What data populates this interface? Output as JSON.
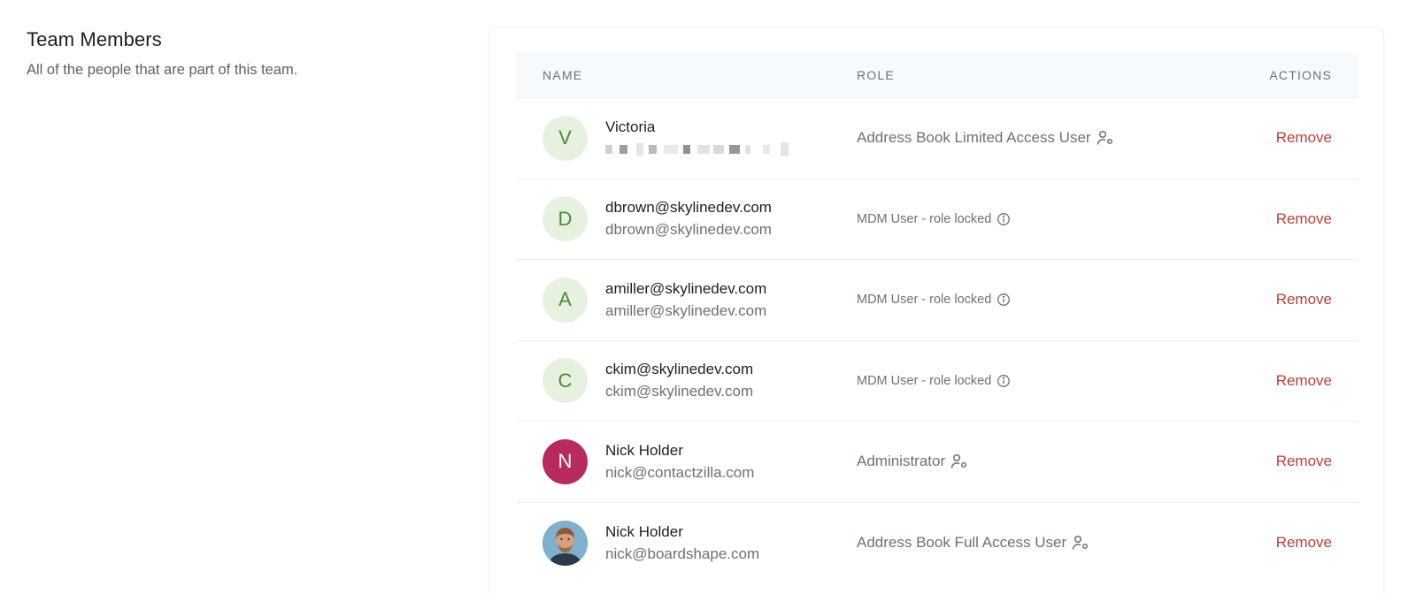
{
  "section": {
    "title": "Team Members",
    "description": "All of the people that are part of this team."
  },
  "table": {
    "headers": {
      "name": "NAME",
      "role": "ROLE",
      "actions": "ACTIONS"
    },
    "rows": [
      {
        "initial": "V",
        "avatar_style": "light",
        "name": "Victoria",
        "email": "",
        "email_redacted": true,
        "role": "Address Book Limited Access User",
        "role_icon": "user-gear-icon",
        "action": "Remove"
      },
      {
        "initial": "D",
        "avatar_style": "light",
        "name": "dbrown@skylinedev.com",
        "email": "dbrown@skylinedev.com",
        "role": "MDM User - role locked",
        "role_icon": "info-icon",
        "action": "Remove"
      },
      {
        "initial": "A",
        "avatar_style": "light",
        "name": "amiller@skylinedev.com",
        "email": "amiller@skylinedev.com",
        "role": "MDM User - role locked",
        "role_icon": "info-icon",
        "action": "Remove"
      },
      {
        "initial": "C",
        "avatar_style": "light",
        "name": "ckim@skylinedev.com",
        "email": "ckim@skylinedev.com",
        "role": "MDM User - role locked",
        "role_icon": "info-icon",
        "action": "Remove"
      },
      {
        "initial": "N",
        "avatar_style": "dark",
        "name": "Nick Holder",
        "email": "nick@contactzilla.com",
        "role": "Administrator",
        "role_icon": "user-gear-icon",
        "action": "Remove"
      },
      {
        "initial": "",
        "avatar_style": "photo",
        "name": "Nick Holder",
        "email": "nick@boardshape.com",
        "role": "Address Book Full Access User",
        "role_icon": "user-gear-icon",
        "action": "Remove"
      }
    ]
  },
  "colors": {
    "accent_remove": "#b9403a",
    "avatar_light_bg": "#e6f2df",
    "avatar_light_fg": "#4e8a34",
    "avatar_dark_bg": "#b8295e",
    "header_bg": "#f7fafc"
  }
}
